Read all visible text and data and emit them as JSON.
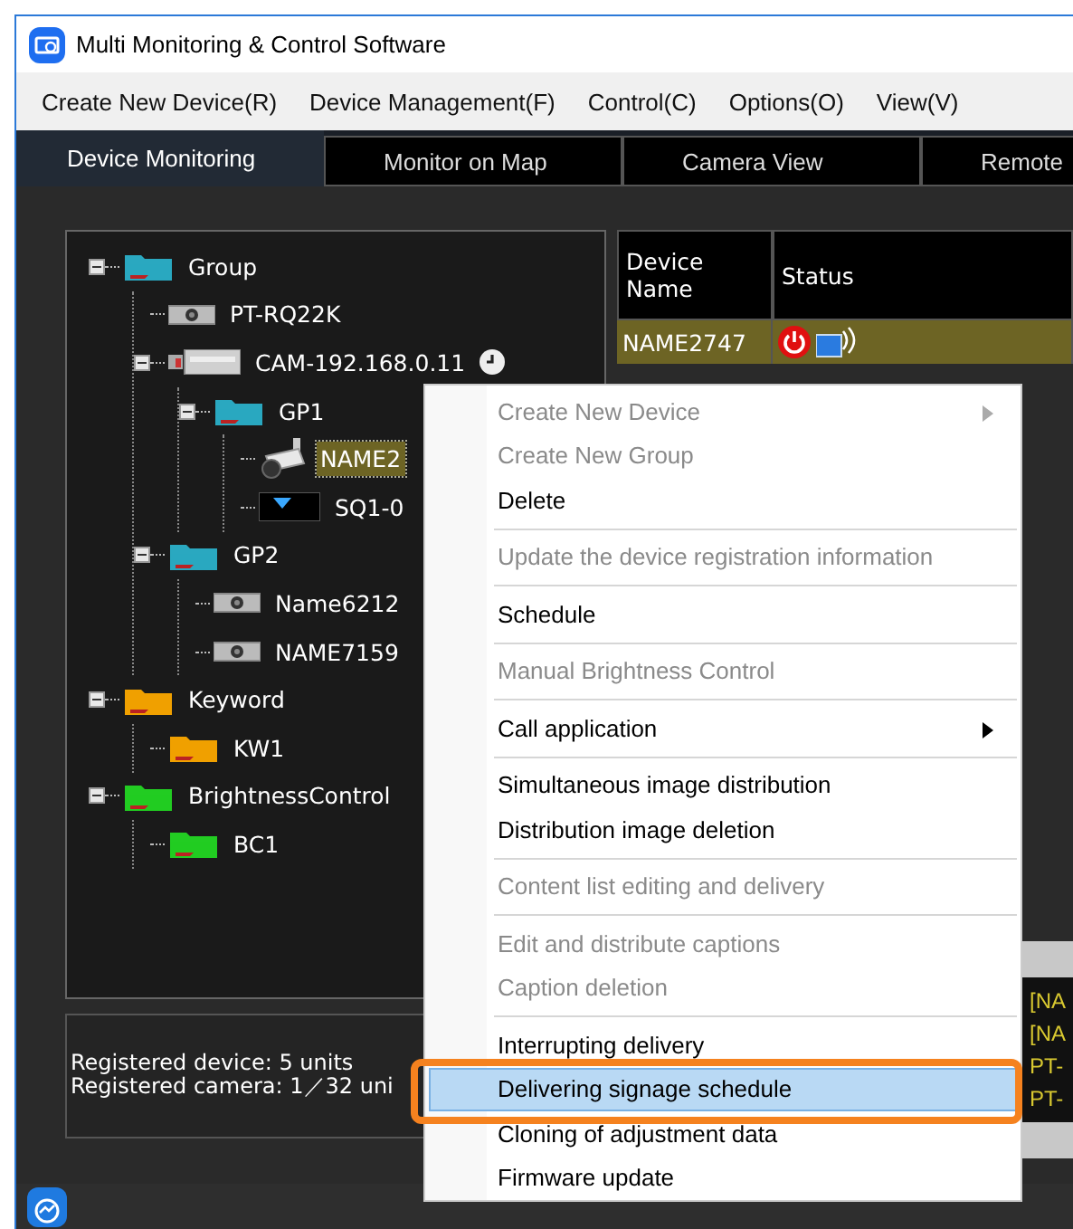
{
  "window": {
    "title": "Multi Monitoring & Control Software"
  },
  "menu_bar": [
    "Create New Device(R)",
    "Device Management(F)",
    "Control(C)",
    "Options(O)",
    "View(V)"
  ],
  "tabs": [
    {
      "label": "Device Monitoring",
      "selected": true
    },
    {
      "label": "Monitor on Map",
      "selected": false
    },
    {
      "label": "Camera View",
      "selected": false
    },
    {
      "label": "Remote",
      "selected": false
    }
  ],
  "tree": [
    {
      "label": "Group",
      "kind": "folder",
      "color": "#2aa8c0",
      "expanded": true,
      "selected": false,
      "children": [
        {
          "label": "PT-RQ22K",
          "kind": "projector",
          "selected": false
        },
        {
          "label": "CAM-192.168.0.11",
          "kind": "camera-box",
          "clock": true,
          "expanded": true,
          "selected": false,
          "children": [
            {
              "label": "GP1",
              "kind": "folder",
              "color": "#2aa8c0",
              "expanded": true,
              "selected": false,
              "children": [
                {
                  "label": "NAME2",
                  "kind": "camera",
                  "selected": true
                },
                {
                  "label": "SQ1-0",
                  "kind": "display",
                  "selected": false
                }
              ]
            }
          ]
        },
        {
          "label": "GP2",
          "kind": "folder",
          "color": "#2aa8c0",
          "expanded": true,
          "selected": false,
          "children": [
            {
              "label": "Name6212",
              "kind": "projector",
              "selected": false
            },
            {
              "label": "NAME7159",
              "kind": "projector",
              "selected": false
            }
          ]
        }
      ]
    },
    {
      "label": "Keyword",
      "kind": "folder",
      "color": "#f0a000",
      "expanded": true,
      "selected": false,
      "children": [
        {
          "label": "KW1",
          "kind": "folder",
          "color": "#f0a000",
          "selected": false
        }
      ]
    },
    {
      "label": "BrightnessControl",
      "kind": "folder",
      "color": "#22cc22",
      "expanded": true,
      "selected": false,
      "children": [
        {
          "label": "BC1",
          "kind": "folder",
          "color": "#22cc22",
          "selected": false
        }
      ]
    }
  ],
  "info": [
    "Registered device: 5 units",
    "Registered camera: 1／32 uni"
  ],
  "table": {
    "columns": [
      "Device Name",
      "Status"
    ],
    "rows": [
      {
        "name": "NAME2747",
        "selected": true,
        "power": true
      }
    ]
  },
  "log_lines": [
    "[NA",
    "[NA",
    "PT-",
    "PT-"
  ],
  "context_menu": {
    "groups": [
      [
        {
          "label": "Create New Device",
          "disabled": true,
          "submenu": true,
          "selected": false
        },
        {
          "label": "Create New Group",
          "disabled": true,
          "submenu": false,
          "selected": false
        },
        {
          "label": "Delete",
          "disabled": false,
          "submenu": false,
          "selected": false
        }
      ],
      [
        {
          "label": "Update the device registration information",
          "disabled": true,
          "submenu": false,
          "selected": false
        }
      ],
      [
        {
          "label": "Schedule",
          "disabled": false,
          "submenu": false,
          "selected": false
        }
      ],
      [
        {
          "label": "Manual Brightness Control",
          "disabled": true,
          "submenu": false,
          "selected": false
        }
      ],
      [
        {
          "label": "Call application",
          "disabled": false,
          "submenu": true,
          "selected": false
        }
      ],
      [
        {
          "label": "Simultaneous image distribution",
          "disabled": false,
          "submenu": false,
          "selected": false
        },
        {
          "label": "Distribution image deletion",
          "disabled": false,
          "submenu": false,
          "selected": false
        }
      ],
      [
        {
          "label": "Content list editing and delivery",
          "disabled": true,
          "submenu": false,
          "selected": false
        }
      ],
      [
        {
          "label": "Edit and distribute captions",
          "disabled": true,
          "submenu": false,
          "selected": false
        },
        {
          "label": "Caption deletion",
          "disabled": true,
          "submenu": false,
          "selected": false
        }
      ],
      [
        {
          "label": "Interrupting delivery",
          "disabled": false,
          "submenu": false,
          "selected": false
        },
        {
          "label": "Delivering signage schedule",
          "disabled": false,
          "submenu": false,
          "selected": true,
          "callout": true
        },
        {
          "label": "Cloning of adjustment data",
          "disabled": false,
          "submenu": false,
          "selected": false
        },
        {
          "label": "Firmware update",
          "disabled": false,
          "submenu": false,
          "selected": false
        }
      ]
    ]
  }
}
